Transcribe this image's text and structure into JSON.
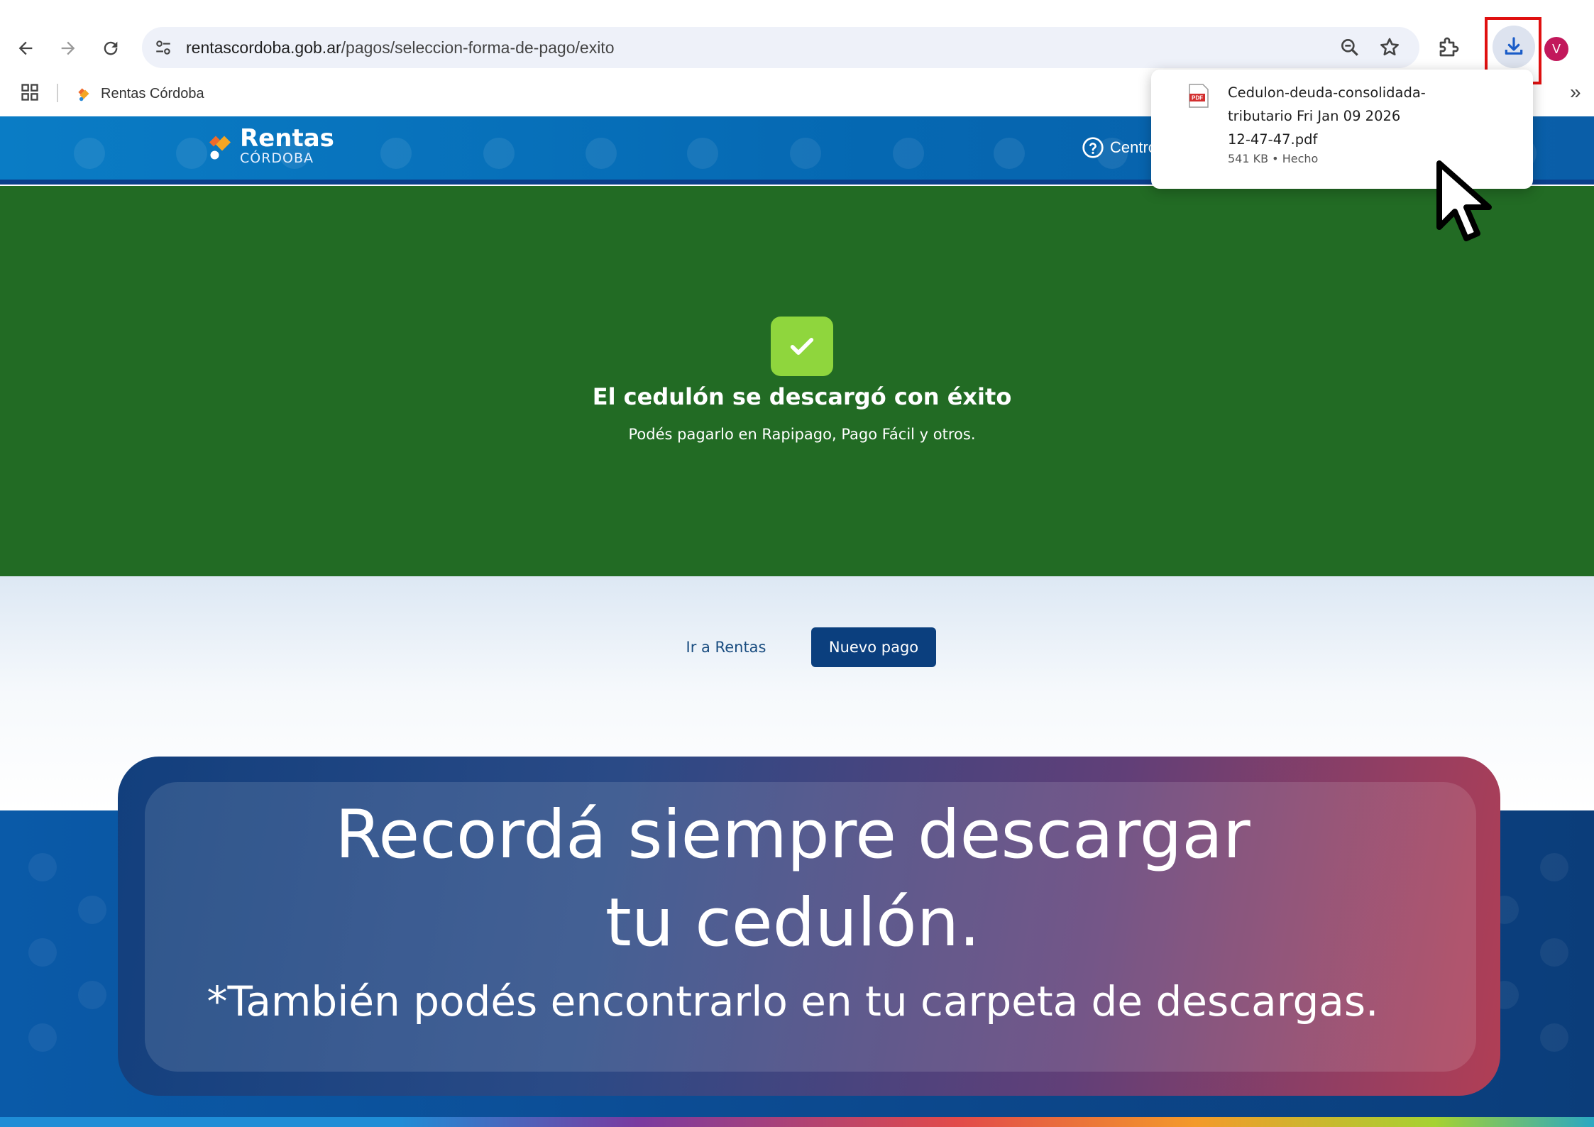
{
  "browser": {
    "url_host": "rentascordoba.gob.ar",
    "url_path": "/pagos/seleccion-forma-de-pago/exito",
    "avatar_initial": "V",
    "bookmark_label": "Rentas Córdoba",
    "bookmarks_overflow": "»",
    "icons": [
      "back-icon",
      "forward-icon",
      "reload-icon",
      "site-info-icon",
      "zoom-icon",
      "star-icon",
      "extensions-icon",
      "download-icon",
      "apps-icon"
    ]
  },
  "download_popup": {
    "filename_line1": "Cedulon-deuda-consolidada-",
    "filename_line2": "tributario Fri Jan 09 2026",
    "filename_line3": "12-47-47.pdf",
    "meta": "541 KB • Hecho",
    "file_type_label": "PDF"
  },
  "site_header": {
    "logo_title": "Rentas",
    "logo_subtitle": "CÓRDOBA",
    "help_label": "Centro"
  },
  "success": {
    "title": "El cedulón se descargó con éxito",
    "subtitle": "Podés pagarlo en Rapipago, Pago Fácil y otros."
  },
  "actions": {
    "secondary_label": "Ir a Rentas",
    "primary_label": "Nuevo pago"
  },
  "reminder": {
    "line1": "Recordá siempre descargar",
    "line2": "tu cedulón.",
    "note": "*También podés encontrarlo en tu carpeta de descargas."
  },
  "colors": {
    "success_green": "#226b24",
    "check_green": "#8fd63d",
    "primary_button": "#0b3f7e",
    "highlight_red": "#e01010",
    "avatar": "#c2185b"
  }
}
